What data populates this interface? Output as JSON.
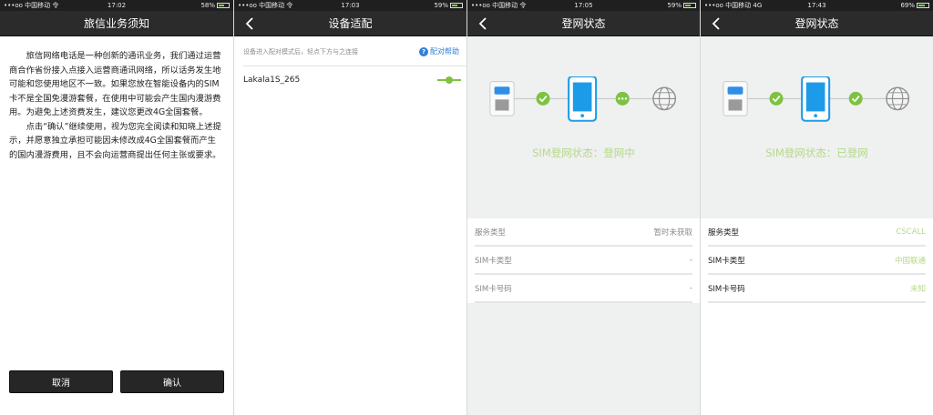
{
  "screen1": {
    "status": {
      "carrier": "•••oo 中国移动 令",
      "time": "17:02",
      "battery": "58%",
      "battery_level": 0.58
    },
    "title": "旅信业务须知",
    "paragraphs": [
      "旅信网络电话是一种创新的通讯业务，我们通过运营商合作省份接入点接入运营商通讯网络，所以话务发生地可能和您使用地区不一致。如果您放在智能设备内的SIM卡不是全国免漫游套餐，在使用中可能会产生国内漫游费用。为避免上述资费发生，建议您更改4G全国套餐。",
      "点击“确认”继续使用，视为您完全阅读和知晓上述提示，并愿意独立承担可能因未修改成4G全国套餐而产生的国内漫游费用，且不会向运营商提出任何主张或要求。"
    ],
    "cancel": "取消",
    "confirm": "确认"
  },
  "screen2": {
    "status": {
      "carrier": "•••oo 中国移动 令",
      "time": "17:03",
      "battery": "59%",
      "battery_level": 0.59
    },
    "title": "设备适配",
    "hint": "设备进入配对模式后，轻点下方与之连接",
    "help": "配对帮助",
    "device_name": "Lakala1S_265"
  },
  "screen3": {
    "status": {
      "carrier": "•••oo 中国移动 令",
      "time": "17:05",
      "battery": "59%",
      "battery_level": 0.59
    },
    "title": "登网状态",
    "state_text": "SIM登网状态：登网中",
    "rows": [
      {
        "label": "服务类型",
        "value": "暂时未获取"
      },
      {
        "label": "SIM卡类型",
        "value": "-"
      },
      {
        "label": "SIM卡号码",
        "value": "-"
      }
    ]
  },
  "screen4": {
    "status": {
      "carrier": "•••oo 中国移动 4G",
      "time": "17:43",
      "battery": "69%",
      "battery_level": 0.69
    },
    "title": "登网状态",
    "state_text": "SIM登网状态：已登网",
    "rows": [
      {
        "label": "服务类型",
        "value": "CSCALL"
      },
      {
        "label": "SIM卡类型",
        "value": "中国联通"
      },
      {
        "label": "SIM卡号码",
        "value": "未知"
      }
    ]
  },
  "colors": {
    "accent_green": "#7ec242",
    "state_text": "#b5d98a",
    "phone_blue": "#1e9be8",
    "help_blue": "#2f7fd6"
  },
  "icons": [
    "back-arrow-icon",
    "check-icon",
    "phone-icon",
    "globe-icon",
    "sim-card-icon",
    "help-icon",
    "toggle-icon"
  ]
}
